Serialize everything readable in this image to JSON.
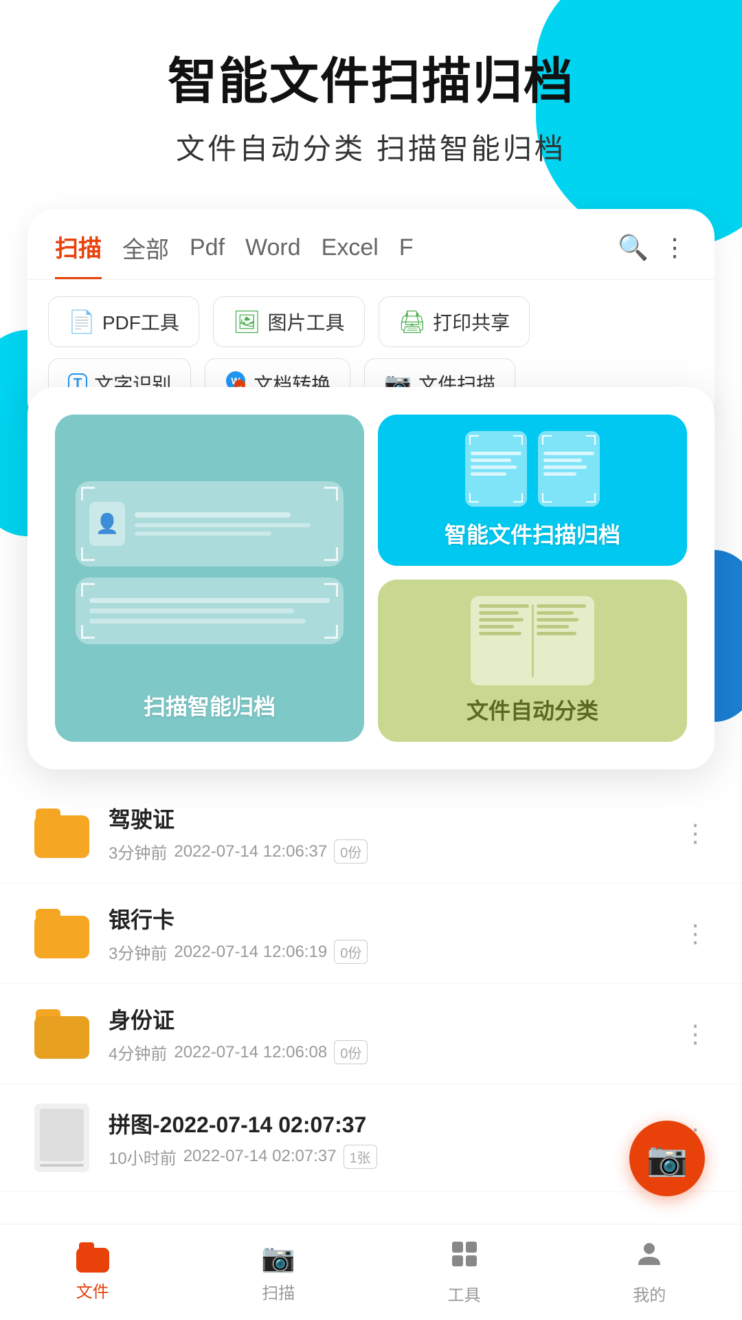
{
  "app": {
    "title": "智能文件扫描归档",
    "subtitle": "文件自动分类   扫描智能归档"
  },
  "tabs": {
    "items": [
      {
        "label": "扫描",
        "active": true
      },
      {
        "label": "全部",
        "active": false
      },
      {
        "label": "Pdf",
        "active": false
      },
      {
        "label": "Word",
        "active": false
      },
      {
        "label": "Excel",
        "active": false
      },
      {
        "label": "F",
        "active": false
      }
    ]
  },
  "tools": {
    "row1": [
      {
        "icon": "📄",
        "label": "PDF工具"
      },
      {
        "icon": "🖼",
        "label": "图片工具"
      },
      {
        "icon": "🖨",
        "label": "打印共享"
      }
    ],
    "row2": [
      {
        "icon": "T",
        "label": "文字识别"
      },
      {
        "icon": "W",
        "label": "文档转换"
      },
      {
        "icon": "📷",
        "label": "文件扫描"
      }
    ]
  },
  "features": {
    "left": {
      "label": "扫描智能归档"
    },
    "right_top": {
      "label": "智能文件扫描归档"
    },
    "right_bottom": {
      "label": "文件自动分类"
    }
  },
  "files": [
    {
      "name": "驾驶证",
      "time": "3分钟前",
      "date": "2022-07-14 12:06:37",
      "count": "0份",
      "type": "folder"
    },
    {
      "name": "银行卡",
      "time": "3分钟前",
      "date": "2022-07-14 12:06:19",
      "count": "0份",
      "type": "folder"
    },
    {
      "name": "身份证",
      "time": "4分钟前",
      "date": "2022-07-14 12:06:08",
      "count": "0份",
      "type": "folder"
    },
    {
      "name": "拼图-2022-07-14 02:07:37",
      "time": "10小时前",
      "date": "2022-07-14 02:07:37",
      "count": "1张",
      "type": "doc"
    }
  ],
  "bottomNav": {
    "items": [
      {
        "label": "文件",
        "active": true,
        "icon": "folder"
      },
      {
        "label": "扫描",
        "active": false,
        "icon": "camera"
      },
      {
        "label": "工具",
        "active": false,
        "icon": "grid"
      },
      {
        "label": "我的",
        "active": false,
        "icon": "person"
      }
    ]
  }
}
